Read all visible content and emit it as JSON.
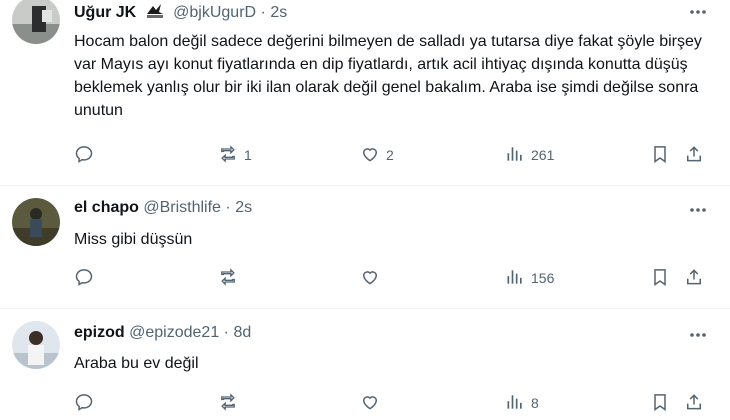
{
  "tweets": [
    {
      "name": "Uğur JK",
      "handle": "@bjkUgurD",
      "sep": "·",
      "time": "2s",
      "text": "Hocam balon değil sadece değerini bilmeyen de salladı ya tutarsa diye fakat şöyle birşey var Mayıs ayı konut fiyatlarında en dip fiyatlardı, artık acil ihtiyaç dışında konutta düşüş beklemek yanlış olur bir iki ilan olarak değil genel bakalım. Araba ise şimdi değilse sonra unutun",
      "replies": "",
      "retweets": "1",
      "likes": "2",
      "views": "261"
    },
    {
      "name": "el chapo",
      "handle": "@Bristhlife",
      "sep": "·",
      "time": "2s",
      "text": "Miss gibi düşsün",
      "replies": "",
      "retweets": "",
      "likes": "",
      "views": "156"
    },
    {
      "name": "epizod",
      "handle": "@epizode21",
      "sep": "·",
      "time": "8d",
      "text": "Araba bu ev değil",
      "replies": "",
      "retweets": "",
      "likes": "",
      "views": "8"
    }
  ],
  "icons": [
    "reply-icon",
    "retweet-icon",
    "like-icon",
    "views-icon",
    "bookmark-icon",
    "share-icon",
    "more-icon"
  ],
  "colors": {
    "text": "#0f1419",
    "muted": "#536471",
    "divider": "#eff3f4"
  }
}
